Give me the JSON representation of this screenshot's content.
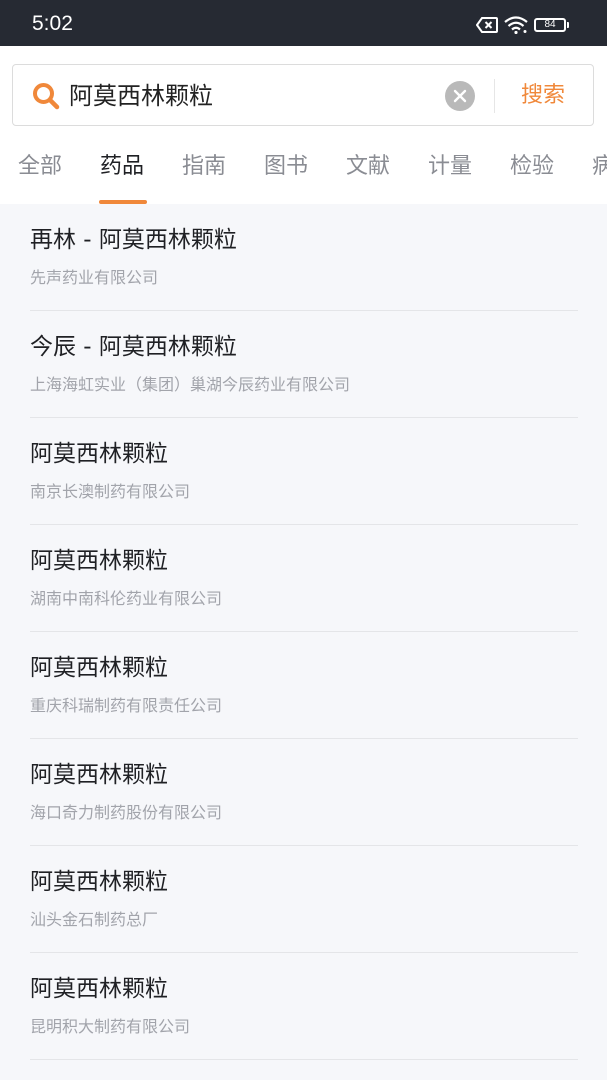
{
  "status_bar": {
    "time": "5:02",
    "battery_level": "84",
    "icons": [
      "sim-off-icon",
      "wifi-icon",
      "battery-icon"
    ]
  },
  "search": {
    "value": "阿莫西林颗粒",
    "placeholder": "",
    "button_label": "搜索",
    "accent_color": "#f0883a"
  },
  "tabs": [
    {
      "label": "全部",
      "active": false
    },
    {
      "label": "药品",
      "active": true
    },
    {
      "label": "指南",
      "active": false
    },
    {
      "label": "图书",
      "active": false
    },
    {
      "label": "文献",
      "active": false
    },
    {
      "label": "计量",
      "active": false
    },
    {
      "label": "检验",
      "active": false
    },
    {
      "label": "病",
      "active": false
    }
  ],
  "results": [
    {
      "title": "再林 - 阿莫西林颗粒",
      "company": "先声药业有限公司"
    },
    {
      "title": "今辰 - 阿莫西林颗粒",
      "company": "上海海虹实业（集团）巢湖今辰药业有限公司"
    },
    {
      "title": "阿莫西林颗粒",
      "company": "南京长澳制药有限公司"
    },
    {
      "title": "阿莫西林颗粒",
      "company": "湖南中南科伦药业有限公司"
    },
    {
      "title": "阿莫西林颗粒",
      "company": "重庆科瑞制药有限责任公司"
    },
    {
      "title": "阿莫西林颗粒",
      "company": "海口奇力制药股份有限公司"
    },
    {
      "title": "阿莫西林颗粒",
      "company": "汕头金石制药总厂"
    },
    {
      "title": "阿莫西林颗粒",
      "company": "昆明积大制药有限公司"
    }
  ]
}
